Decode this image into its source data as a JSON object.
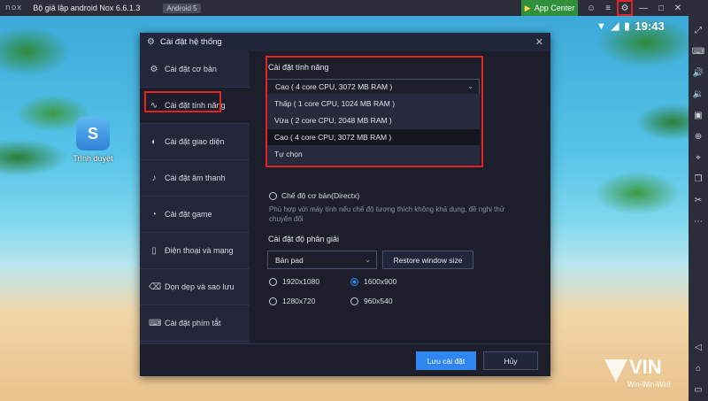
{
  "titlebar": {
    "logo": "nox",
    "title": "Bộ giả lập android Nox 6.6.1.3",
    "android_badge": "Android 5",
    "app_center": "App Center"
  },
  "status": {
    "time": "19:43"
  },
  "desktop": {
    "app_label": "Trình duyệt"
  },
  "dialog": {
    "title": "Cài đặt hệ thống",
    "sidebar": [
      {
        "label": "Cài đặt cơ bản",
        "icon": "gear-icon"
      },
      {
        "label": "Cài đặt tính năng",
        "icon": "pulse-icon"
      },
      {
        "label": "Cài đặt giao diện",
        "icon": "palette-icon"
      },
      {
        "label": "Cài đặt âm thanh",
        "icon": "speaker-icon"
      },
      {
        "label": "Cài đặt game",
        "icon": "gauge-icon"
      },
      {
        "label": "Điện thoại và mạng",
        "icon": "phone-icon"
      },
      {
        "label": "Dọn dẹp và sao lưu",
        "icon": "broom-icon"
      },
      {
        "label": "Cài đặt phím tắt",
        "icon": "keyboard-icon"
      }
    ],
    "performance": {
      "label": "Cài đặt tính năng",
      "selected": "Cao ( 4 core CPU, 3072 MB RAM )",
      "options": [
        "Thấp ( 1 core CPU, 1024 MB RAM )",
        "Vừa ( 2 core CPU, 2048 MB RAM )",
        "Cao ( 4 core CPU, 3072 MB RAM )",
        "Tự chọn"
      ]
    },
    "render": {
      "option": "Chế độ cơ bản(Directx)",
      "note": "Phù hợp với máy tính nếu chế độ tương thích không khả dụng, đề nghị thử chuyển đổi"
    },
    "resolution": {
      "label": "Cài đặt độ phân giải",
      "device": "Bản pad",
      "restore": "Restore window size",
      "options": [
        "1920x1080",
        "1600x900",
        "1280x720",
        "960x540"
      ],
      "selected": "1600x900"
    },
    "footer": {
      "save": "Lưu cài đặt",
      "cancel": "Hủy"
    }
  },
  "watermark": {
    "brand": "VIN",
    "slogan": "Win-Win-Win!"
  }
}
